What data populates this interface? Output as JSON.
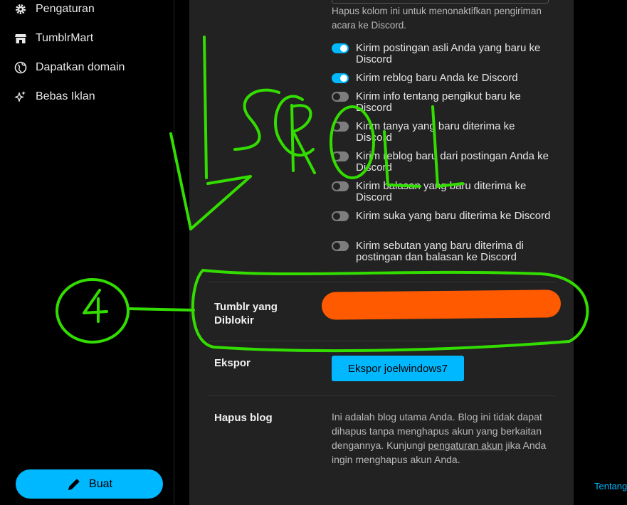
{
  "sidebar": {
    "items": [
      {
        "label": "Pengaturan",
        "icon": "gear-icon"
      },
      {
        "label": "TumblrMart",
        "icon": "store-icon"
      },
      {
        "label": "Dapatkan domain",
        "icon": "globe-icon"
      },
      {
        "label": "Bebas Iklan",
        "icon": "sparkle-icon"
      }
    ],
    "create_label": "Buat"
  },
  "discord": {
    "hint": "Hapus kolom ini untuk menonaktifkan pengiriman acara ke Discord.",
    "toggles": [
      {
        "label": "Kirim postingan asli Anda yang baru ke Discord",
        "on": true
      },
      {
        "label": "Kirim reblog baru Anda ke Discord",
        "on": true
      },
      {
        "label": "Kirim info tentang pengikut baru ke Discord",
        "on": false
      },
      {
        "label": "Kirim tanya yang baru diterima ke Discord",
        "on": false
      },
      {
        "label": "Kirim reblog baru dari postingan Anda ke Discord",
        "on": false
      },
      {
        "label": "Kirim balasan yang baru diterima ke Discord",
        "on": false
      },
      {
        "label": "Kirim suka yang baru diterima ke Discord",
        "on": false
      },
      {
        "label": "Kirim sebutan yang baru diterima di postingan dan balasan ke Discord",
        "on": false
      }
    ]
  },
  "blocked": {
    "label": "Tumblr yang Diblokir"
  },
  "export": {
    "label": "Ekspor",
    "button": "Ekspor joelwindows7"
  },
  "delete": {
    "label": "Hapus blog",
    "text_before": "Ini adalah blog utama Anda. Blog ini tidak dapat dihapus tanpa menghapus akun yang berkaitan dengannya. Kunjungi ",
    "link": "pengaturan akun",
    "text_after": " jika Anda ingin menghapus akun Anda."
  },
  "footer": {
    "link": "Tentang"
  },
  "annotation": {
    "scroll_text": "SCROLL",
    "step_number": "4",
    "color": "#33dd00",
    "redaction_color": "#ff5a00"
  },
  "colors": {
    "accent": "#00b8ff",
    "panel": "#222222",
    "background": "#000000"
  }
}
